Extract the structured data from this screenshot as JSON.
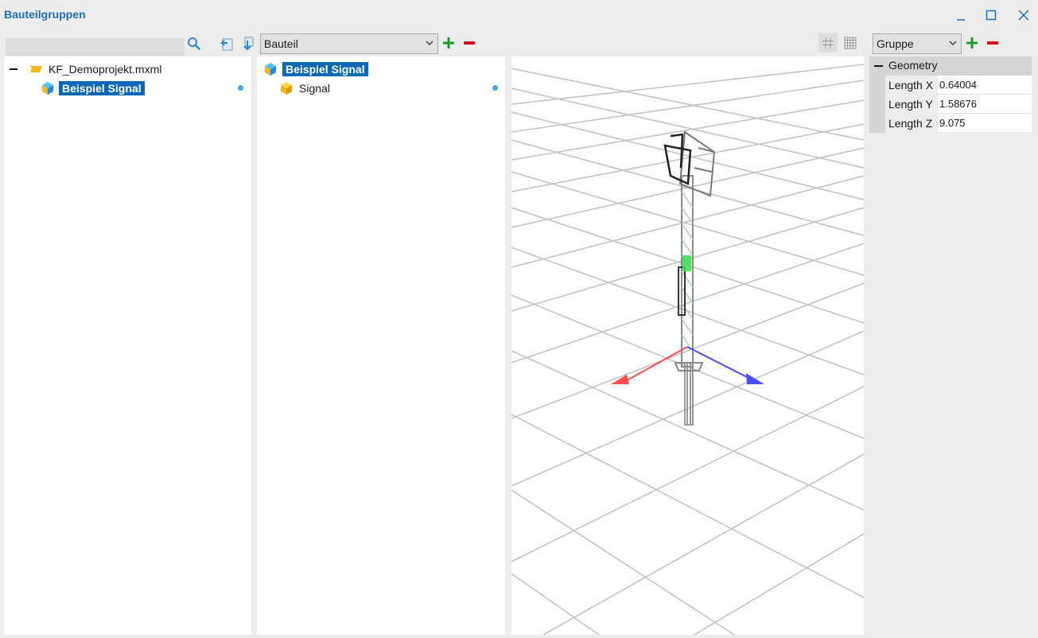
{
  "window": {
    "title": "Bauteilgruppen"
  },
  "search": {
    "value": "",
    "placeholder": ""
  },
  "left_tree": {
    "root": {
      "label": "KF_Demoprojekt.mxml"
    },
    "child": {
      "label": "Beispiel Signal"
    }
  },
  "middle": {
    "dropdown_value": "Bauteil",
    "tree": {
      "root": {
        "label": "Beispiel Signal"
      },
      "child": {
        "label": "Signal"
      }
    }
  },
  "properties": {
    "dropdown_value": "Gruppe",
    "group_label": "Geometry",
    "rows": [
      {
        "name": "Length X",
        "value": "0.64004"
      },
      {
        "name": "Length Y",
        "value": "1.58676"
      },
      {
        "name": "Length Z",
        "value": "9.075"
      }
    ]
  },
  "colors": {
    "accent": "#1f6fb5",
    "selection": "#0a68b4",
    "add": "#1a9c2a",
    "remove": "#d9001b",
    "axis_x": "#ff4d4d",
    "axis_z": "#4d4dff",
    "axis_y": "#3ddc4f"
  },
  "icons": [
    "search-icon",
    "import-icon",
    "export-icon",
    "add-icon",
    "remove-icon",
    "grid-icon",
    "grid-fine-icon",
    "minimize-icon",
    "maximize-icon",
    "close-icon",
    "folder-icon",
    "component-group-icon",
    "component-icon"
  ]
}
